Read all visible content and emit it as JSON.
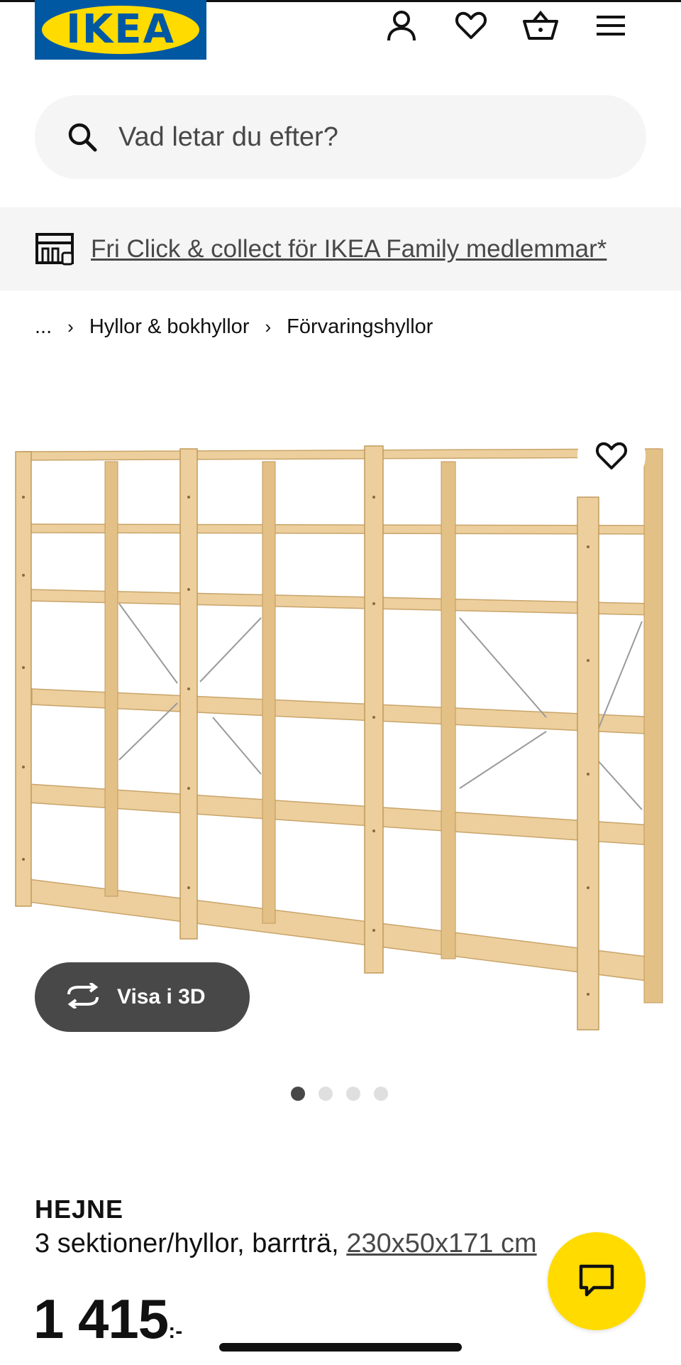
{
  "header": {
    "logo_text": "IKEA",
    "logo_reg": "®",
    "icons": [
      "user-icon",
      "heart-icon",
      "basket-icon",
      "menu-icon"
    ]
  },
  "search": {
    "placeholder": "Vad letar du efter?"
  },
  "banner": {
    "text": "Fri Click & collect för IKEA Family medlemmar*"
  },
  "breadcrumb": {
    "ellipsis": "...",
    "items": [
      "Hyllor & bokhyllor",
      "Förvaringshyllor"
    ]
  },
  "gallery": {
    "view3d_label": "Visa i 3D",
    "slide_count": 4,
    "active_index": 0
  },
  "product": {
    "name": "HEJNE",
    "description": "3 sektioner/hyllor, barrträ, ",
    "dimensions": "230x50x171 cm",
    "price": "1 415",
    "price_suffix": ":-"
  },
  "colors": {
    "ikea_blue": "#0058a3",
    "ikea_yellow": "#ffdb00",
    "dark_grey": "#484848",
    "light_grey": "#f5f5f5",
    "wood": "#e8c894"
  }
}
